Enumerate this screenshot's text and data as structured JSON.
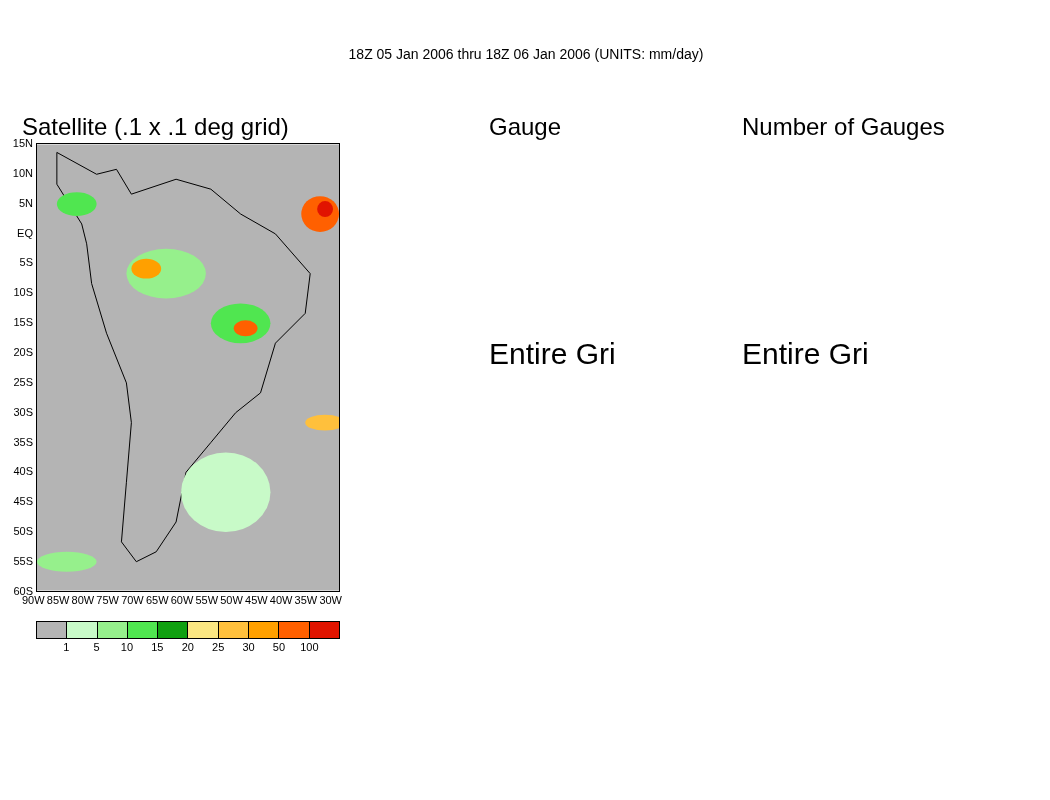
{
  "title": "18Z 05 Jan 2006 thru 18Z 06 Jan 2006 (UNITS: mm/day)",
  "panels": [
    {
      "kind": "map",
      "title": "Satellite (.1 x .1 deg grid)",
      "lat_labels": [
        "15N",
        "10N",
        "5N",
        "EQ",
        "5S",
        "10S",
        "15S",
        "20S",
        "25S",
        "30S",
        "35S",
        "40S",
        "45S",
        "50S",
        "55S",
        "60S"
      ],
      "lon_labels": [
        "90W",
        "85W",
        "80W",
        "75W",
        "70W",
        "65W",
        "60W",
        "55W",
        "50W",
        "45W",
        "40W",
        "35W",
        "30W"
      ],
      "legend": {
        "swatches": [
          {
            "color": "#b4b4b4"
          },
          {
            "color": "#c8fac8"
          },
          {
            "color": "#96f08c"
          },
          {
            "color": "#50e650"
          },
          {
            "color": "#10a010"
          },
          {
            "color": "#fae682"
          },
          {
            "color": "#ffc03c"
          },
          {
            "color": "#ffa000"
          },
          {
            "color": "#ff6000"
          },
          {
            "color": "#e11400"
          }
        ],
        "labels": [
          "1",
          "5",
          "10",
          "15",
          "20",
          "25",
          "30",
          "50",
          "100"
        ]
      }
    },
    {
      "kind": "text",
      "title": "Gauge",
      "message": "Entire Gri"
    },
    {
      "kind": "text",
      "title": "Number of Gauges",
      "message": "Entire Gri"
    }
  ]
}
